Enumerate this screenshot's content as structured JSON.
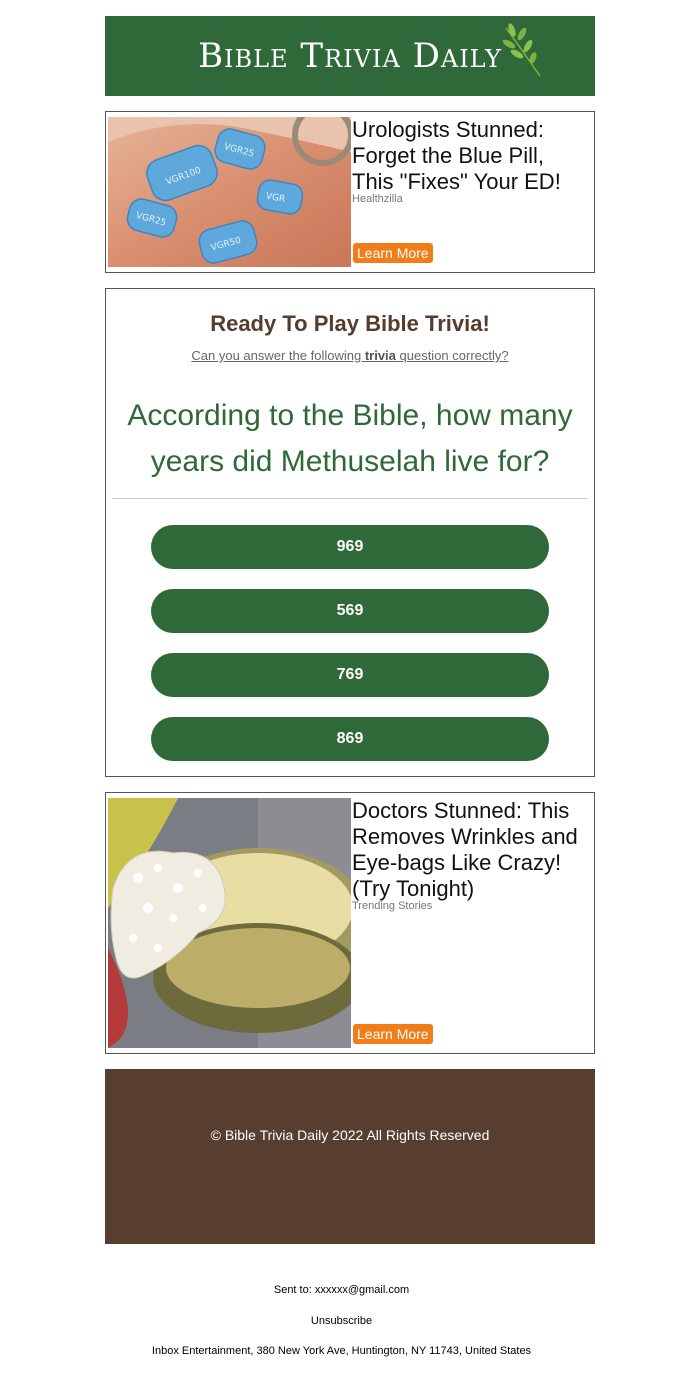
{
  "header": {
    "logo_text": "Bible Trivia Daily",
    "bg_color": "#2f6839"
  },
  "ads": [
    {
      "title": "Urologists Stunned: Forget the Blue Pill, This \"Fixes\" Your ED!",
      "source": "Healthzilla",
      "button_label": "Learn More",
      "image": "blue-pills-photo"
    },
    {
      "title": "Doctors Stunned: This Removes Wrinkles and Eye-bags Like Crazy! (Try Tonight)",
      "source": "Trending Stories",
      "button_label": "Learn More",
      "image": "scrub-jar-photo"
    }
  ],
  "trivia": {
    "heading": "Ready To Play Bible Trivia!",
    "subtitle_prefix": "Can you answer the following ",
    "subtitle_bold": "trivia",
    "subtitle_suffix": " question correctly?",
    "question": "According to the Bible, how many years did Methuselah live for?",
    "answers": [
      "969",
      "569",
      "769",
      "869"
    ]
  },
  "footer": {
    "copyright": "© Bible Trivia Daily 2022 All Rights Reserved",
    "bg_color": "#573e2f"
  },
  "meta": {
    "sent_to": "Sent to: xxxxxx@gmail.com",
    "unsubscribe": "Unsubscribe",
    "address": "Inbox Entertainment, 380 New York Ave, Huntington, NY 11743, United States"
  },
  "colors": {
    "accent_green": "#2f6839",
    "button_orange": "#f07d1a",
    "heading_brown": "#553c2c"
  }
}
